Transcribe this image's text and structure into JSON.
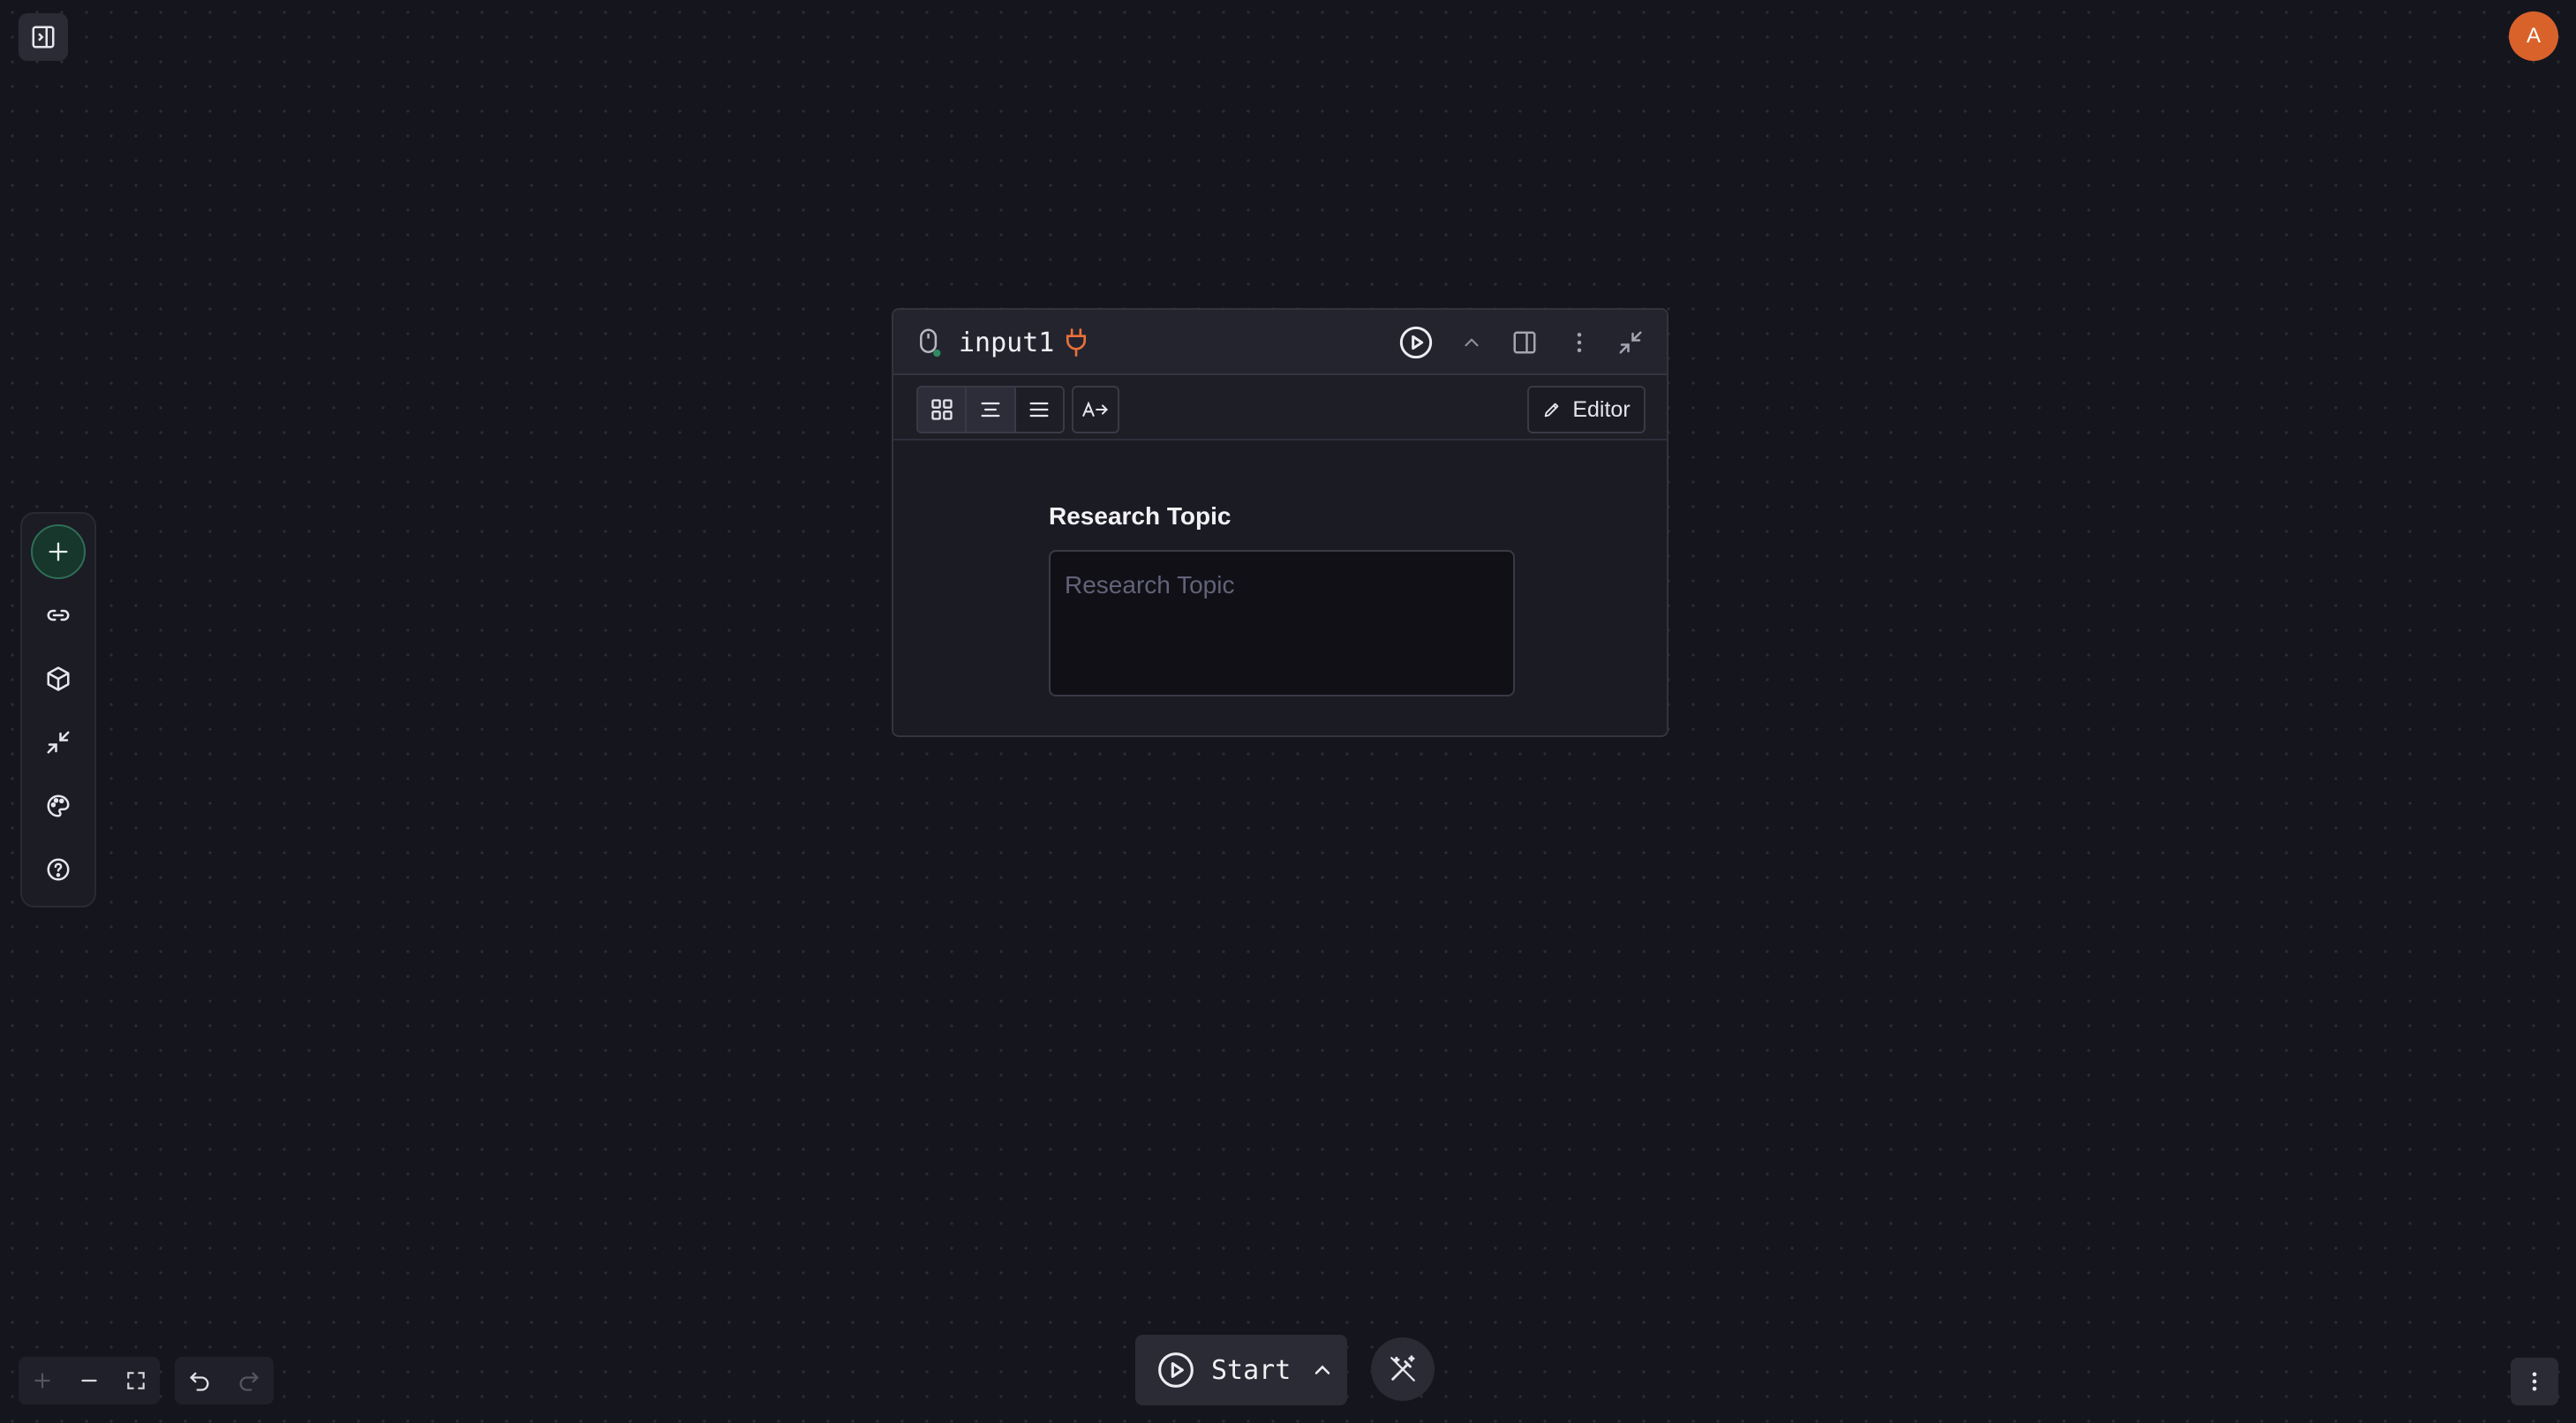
{
  "avatar": {
    "initial": "A"
  },
  "node": {
    "title": "input1",
    "editor_label": "Editor",
    "field": {
      "label": "Research Topic",
      "placeholder": "Research Topic",
      "value": ""
    }
  },
  "toolbar_rail": {
    "items": [
      "plus-icon",
      "link-icon",
      "cube-icon",
      "collapse-icon",
      "palette-icon",
      "help-icon"
    ]
  },
  "bottom": {
    "start_label": "Start"
  },
  "colors": {
    "canvas": "#15151d",
    "avatar": "#d9622b",
    "plug_accent": "#e9703a",
    "add_button": "#2f6e56"
  }
}
